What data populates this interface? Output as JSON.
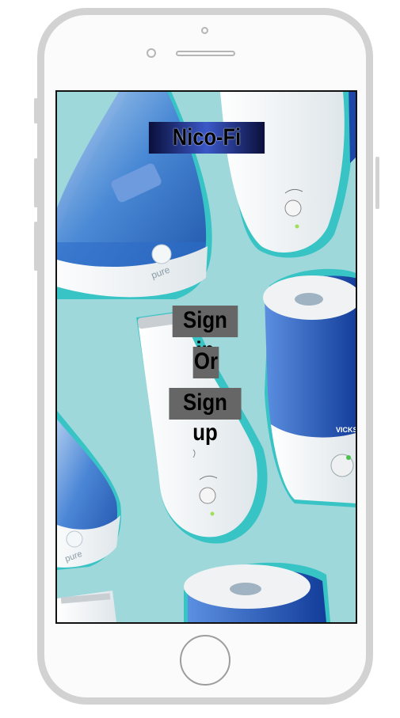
{
  "app": {
    "title": "Nico-Fi",
    "sign_in_label": "Sign in",
    "or_label": "Or",
    "sign_up_label": "Sign up"
  },
  "background": {
    "brand_marks": [
      "pure",
      "pure",
      "VICKS"
    ]
  },
  "colors": {
    "background": "#9ed8db",
    "humidifier_blue": "#2f6fd0",
    "title_gradient_center": "#3b58c8",
    "label_box": "#666666"
  }
}
